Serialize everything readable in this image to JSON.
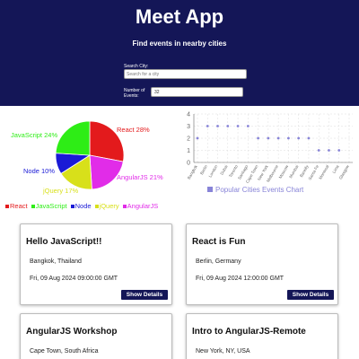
{
  "header": {
    "title": "Meet App",
    "subtitle": "Find events in nearby cities",
    "city_label": "Search City:",
    "city_placeholder": "Search for a city",
    "events_label": "Number of Events:",
    "events_value": "32"
  },
  "colors": {
    "header_bg": "#141657",
    "button_bg": "#141657",
    "react": "#e31a1c",
    "javascript": "#2eed16",
    "node": "#1a1ad6",
    "jquery": "#d8e01a",
    "angularjs": "#e12ce8",
    "scatter_point": "#8884d8"
  },
  "pie_chart": {
    "type": "pie",
    "slices": [
      {
        "name": "React",
        "percent": 28,
        "label": "React 28%",
        "color": "#e31a1c"
      },
      {
        "name": "AngularJS",
        "percent": 21,
        "label": "AngularJS 21%",
        "color": "#e12ce8"
      },
      {
        "name": "jQuery",
        "percent": 17,
        "label": "jQuery 17%",
        "color": "#d8e01a"
      },
      {
        "name": "Node",
        "percent": 10,
        "label": "Node 10%",
        "color": "#1a1ad6"
      },
      {
        "name": "JavaScript",
        "percent": 24,
        "label": "JavaScript 24%",
        "color": "#2eed16"
      }
    ],
    "legend": [
      "React",
      "JavaScript",
      "Node",
      "jQuery",
      "AngularJS"
    ]
  },
  "chart_data": {
    "type": "scatter",
    "title": "Popular Cities Events Chart",
    "ylim": [
      0,
      4
    ],
    "yticks": [
      0,
      1,
      2,
      3,
      4
    ],
    "categories": [
      "Bangkok",
      "Berlin",
      "London",
      "Dubai",
      "Toronto",
      "Santiago",
      "Cape Town",
      "New York",
      "Melbourne",
      "Moscow",
      "Mumbai",
      "Bareilly",
      "Santa Fe",
      "Montreal",
      "Lima",
      "Glasgow"
    ],
    "values": [
      2,
      3,
      3,
      3,
      3,
      3,
      2,
      2,
      2,
      2,
      2,
      2,
      1,
      1,
      1
    ],
    "grid": true
  },
  "events": [
    {
      "title": "Hello JavaScript!!",
      "location": "Bangkok, Thailand",
      "date": "Fri, 09 Aug 2024 09:00:00 GMT",
      "button": "Show Details"
    },
    {
      "title": "React is Fun",
      "location": "Berlin, Germany",
      "date": "Fri, 09 Aug 2024 12:00:00 GMT",
      "button": "Show Details"
    },
    {
      "title": "AngularJS Workshop",
      "location": "Cape Town, South Africa",
      "date": "",
      "button": ""
    },
    {
      "title": "Intro to AngularJS-Remote",
      "location": "New York, NY, USA",
      "date": "",
      "button": ""
    }
  ]
}
